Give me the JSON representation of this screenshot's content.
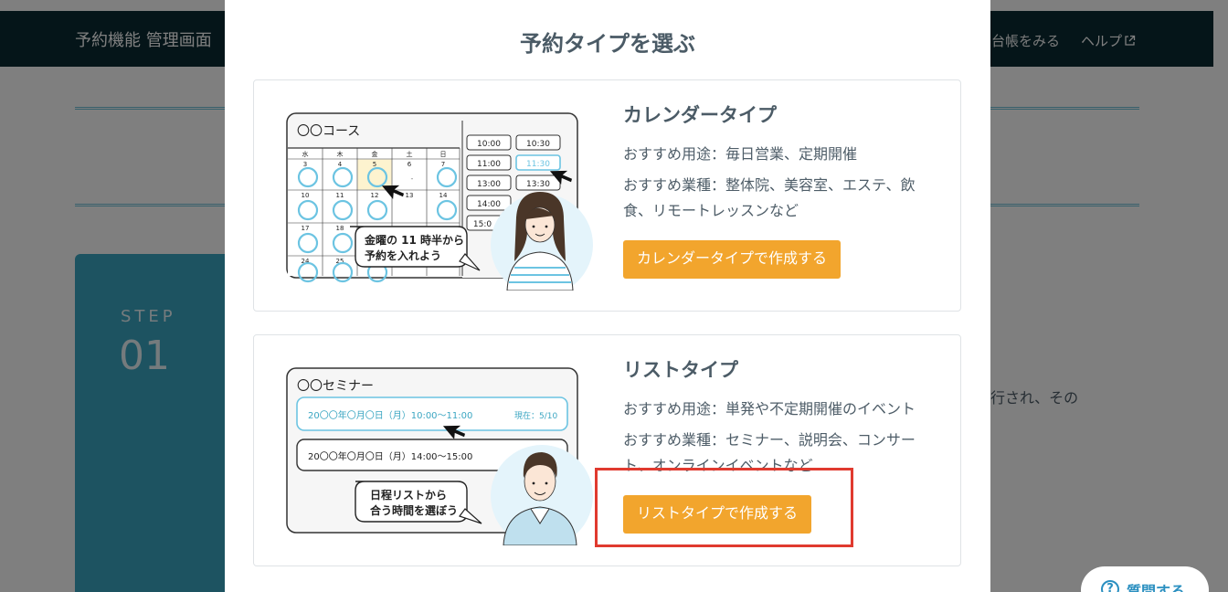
{
  "header": {
    "app_title": "予約機能 管理画面",
    "ledger_link": "台帳をみる",
    "help_link": "ヘルプ"
  },
  "step": {
    "label": "STEP",
    "number": "01",
    "text_fragment": "行され、その"
  },
  "help_float": {
    "icon": "?",
    "label": "質問する"
  },
  "modal": {
    "title": "予約タイプを選ぶ",
    "calendar": {
      "title": "カレンダータイプ",
      "use_case": "おすすめ用途：毎日営業、定期開催",
      "industries": "おすすめ業種：整体院、美容室、エステ、飲食、リモートレッスンなど",
      "button": "カレンダータイプで作成する",
      "illustration": {
        "course_name": "〇〇コース",
        "weekdays": [
          "水",
          "木",
          "金",
          "土",
          "日"
        ],
        "dates_row1": [
          "3",
          "4",
          "5",
          "6",
          "7"
        ],
        "dates_row2": [
          "10",
          "11",
          "12",
          "13",
          "14"
        ],
        "dates_row3": [
          "17",
          "18"
        ],
        "dates_row4": [
          "24",
          "25"
        ],
        "times": [
          "10:00",
          "10:30",
          "11:00",
          "11:30",
          "13:00",
          "13:30",
          "14:00",
          "15:0"
        ],
        "bubble_line1": "金曜の 11 時半から",
        "bubble_line2": "予約を入れよう"
      }
    },
    "list": {
      "title": "リストタイプ",
      "use_case": "おすすめ用途：単発や不定期開催のイベント",
      "industries": "おすすめ業種：セミナー、説明会、コンサート、オンラインイベントなど",
      "button": "リストタイプで作成する",
      "illustration": {
        "seminar_name": "〇〇セミナー",
        "slot1": "20〇〇年〇月〇日（月）10:00〜11:00",
        "slot1_status": "現在：5/10",
        "slot2": "20〇〇年〇月〇日（月）14:00〜15:00",
        "bubble_line1": "日程リストから",
        "bubble_line2": "合う時間を選ぼう"
      }
    }
  },
  "colors": {
    "header_bg": "#0b2a33",
    "accent_orange": "#f2a52d",
    "highlight_red": "#e03a2f",
    "teal": "#3ba6c2",
    "select_blue": "#6cc4e2"
  }
}
